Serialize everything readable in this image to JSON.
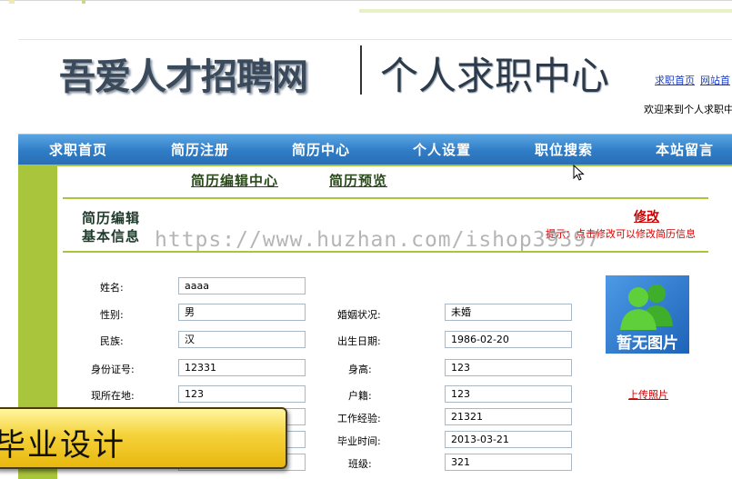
{
  "header": {
    "site_title": "吾爱人才招聘网",
    "section_title": "个人求职中心",
    "links": [
      "求职首页",
      "网站首"
    ],
    "welcome": "欢迎来到个人求职中"
  },
  "nav": [
    "求职首页",
    "简历注册",
    "简历中心",
    "个人设置",
    "职位搜索",
    "本站留言"
  ],
  "tabs": [
    "简历编辑中心",
    "简历预览"
  ],
  "section": {
    "title_line1": "简历编辑",
    "title_line2": "基本信息",
    "edit_link": "修改",
    "hint": "提示：点击修改可以修改简历信息"
  },
  "watermark": "https://www.huzhan.com/ishop39397",
  "form": {
    "name_label": "姓名:",
    "name_value": "aaaa",
    "gender_label": "性别:",
    "gender_value": "男",
    "marital_label": "婚姻状况:",
    "marital_value": "未婚",
    "ethnicity_label": "民族:",
    "ethnicity_value": "汉",
    "birthdate_label": "出生日期:",
    "birthdate_value": "1986-02-20",
    "idcard_label": "身份证号:",
    "idcard_value": "12331",
    "height_label": "身高:",
    "height_value": "123",
    "location_label": "现所在地:",
    "location_value": "123",
    "hukou_label": "户籍:",
    "hukou_value": "123",
    "experience_label": "工作经验:",
    "experience_value": "21321",
    "graduation_label": "毕业时间:",
    "graduation_value": "2013-03-21",
    "class_label": "班级:",
    "class_value": "321"
  },
  "photo": {
    "placeholder_text": "暂无图片",
    "upload_link": "上传照片"
  },
  "overlay": {
    "promo_text": "毕业设计"
  },
  "colors": {
    "nav_blue": "#2f7cc6",
    "frame_green": "#a9c53b",
    "link_red": "#cc0000",
    "promo_yellow": "#f4d23a"
  }
}
